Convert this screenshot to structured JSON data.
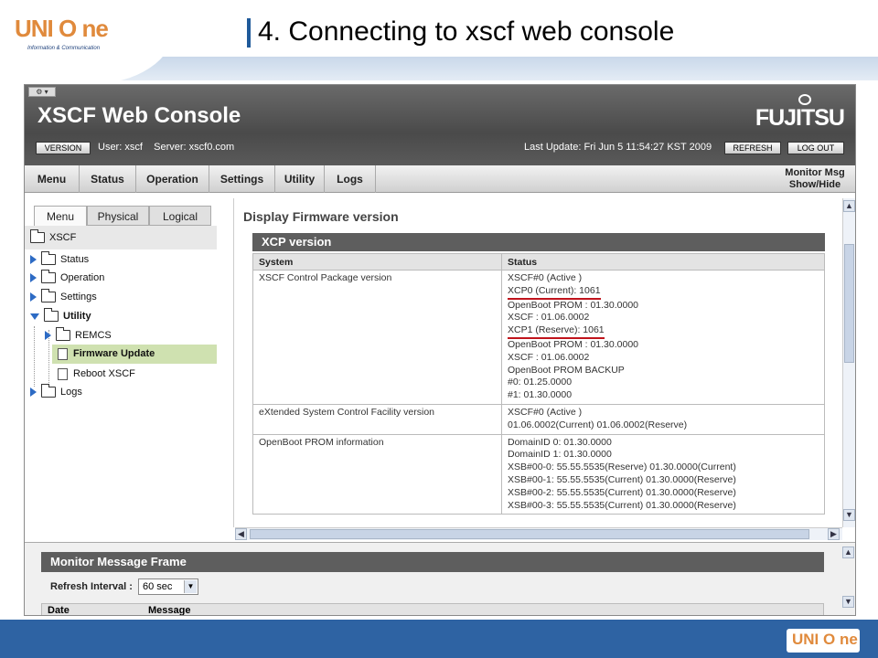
{
  "slide": {
    "title": "4. Connecting to xscf web console",
    "logo_text": "UNI O ne",
    "logo_sub": "Information & Communication"
  },
  "app": {
    "title": "XSCF Web Console",
    "brand": "FUJITSU",
    "version_button": "VERSION",
    "user_label": "User:",
    "user": "xscf",
    "server_label": "Server:",
    "server": "xscf0.com",
    "last_update_label": "Last Update:",
    "last_update": "Fri Jun 5 11:54:27 KST 2009",
    "refresh_button": "REFRESH",
    "logout_button": "LOG OUT"
  },
  "menubar": {
    "items": [
      "Menu",
      "Status",
      "Operation",
      "Settings",
      "Utility",
      "Logs"
    ],
    "monitor_msg": "Monitor Msg",
    "show_hide": "Show/Hide"
  },
  "nav": {
    "tabs": [
      "Menu",
      "Physical",
      "Logical"
    ],
    "root": "XSCF",
    "items": [
      "Status",
      "Operation",
      "Settings",
      "Utility",
      "REMCS",
      "Firmware Update",
      "Reboot XSCF",
      "Logs"
    ]
  },
  "main": {
    "heading": "Display Firmware version",
    "section": "XCP version",
    "columns": [
      "System",
      "Status"
    ],
    "rows": [
      {
        "system": "XSCF Control Package version",
        "status": [
          "XSCF#0 (Active )",
          "XCP0 (Current): 1061",
          "OpenBoot PROM : 01.30.0000",
          "XSCF : 01.06.0002",
          "XCP1 (Reserve): 1061",
          "OpenBoot PROM : 01.30.0000",
          "XSCF : 01.06.0002",
          "OpenBoot PROM BACKUP",
          "#0: 01.25.0000",
          "#1: 01.30.0000"
        ]
      },
      {
        "system": "eXtended System Control Facility version",
        "status": [
          "XSCF#0 (Active )",
          "01.06.0002(Current) 01.06.0002(Reserve)"
        ]
      },
      {
        "system": "OpenBoot PROM information",
        "status": [
          "DomainID 0: 01.30.0000",
          "DomainID 1: 01.30.0000",
          "XSB#00-0: 55.55.5535(Reserve) 01.30.0000(Current)",
          "XSB#00-1: 55.55.5535(Current) 01.30.0000(Reserve)",
          "XSB#00-2: 55.55.5535(Current) 01.30.0000(Reserve)",
          "XSB#00-3: 55.55.5535(Current) 01.30.0000(Reserve)"
        ]
      }
    ]
  },
  "monitor_frame": {
    "title": "Monitor Message Frame",
    "refresh_label": "Refresh Interval :",
    "refresh_value": "60 sec",
    "columns": [
      "Date",
      "Message"
    ]
  },
  "colors": {
    "footer": "#2e63a3",
    "header_dark": "#5a5a5a",
    "highlight": "#cfe1b0",
    "underline": "#c0141c",
    "logo": "#e08a3c"
  }
}
